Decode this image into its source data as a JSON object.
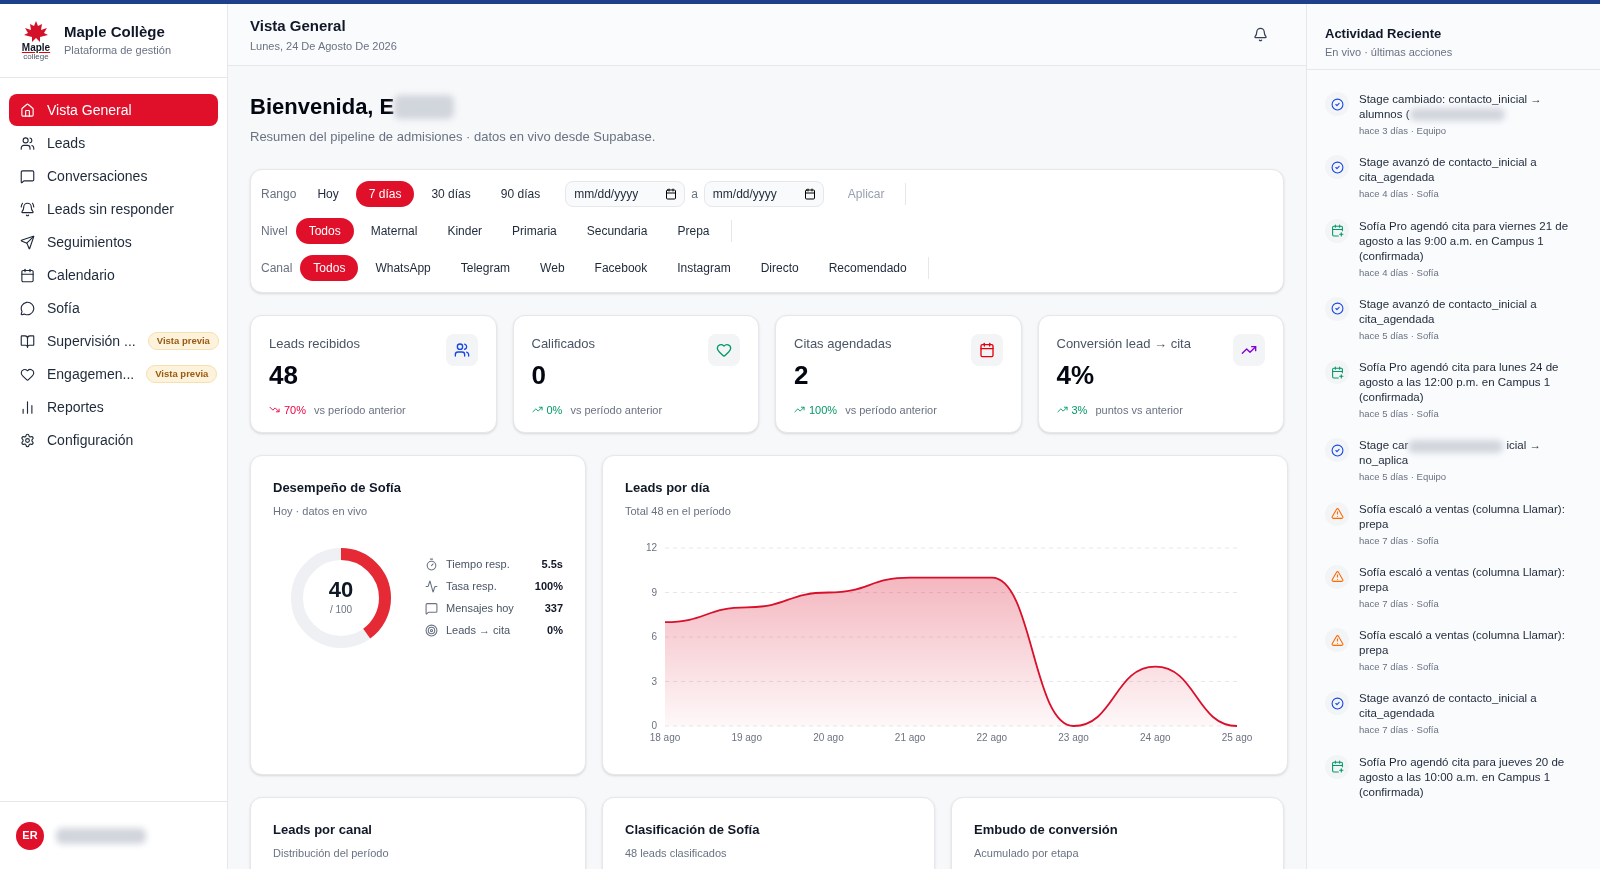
{
  "sidebar": {
    "logo": {
      "text": "Maple",
      "sub": "college"
    },
    "brand": "Maple Collège",
    "tagline": "Plataforma de gestión",
    "items": [
      {
        "label": "Vista General",
        "selected": true
      },
      {
        "label": "Leads",
        "selected": false
      },
      {
        "label": "Conversaciones",
        "selected": false
      },
      {
        "label": "Leads sin responder",
        "selected": false
      },
      {
        "label": "Seguimientos",
        "selected": false
      },
      {
        "label": "Calendario",
        "selected": false
      },
      {
        "label": "Sofía",
        "selected": false
      },
      {
        "label": "Supervisión ...",
        "selected": false,
        "badge": "Vista previa"
      },
      {
        "label": "Engagemen...",
        "selected": false,
        "badge": "Vista previa"
      },
      {
        "label": "Reportes",
        "selected": false
      },
      {
        "label": "Configuración",
        "selected": false
      }
    ],
    "user": {
      "initials": "ER"
    }
  },
  "header": {
    "title": "Vista General",
    "date": "Lunes, 24 De Agosto De 2026"
  },
  "welcome": {
    "title": "Bienvenida, E",
    "subtitle": "Resumen del pipeline de admisiones · datos en vivo desde Supabase."
  },
  "filters": [
    {
      "label": "Rango",
      "options": [
        {
          "label": "Hoy",
          "selected": false
        },
        {
          "label": "7 días",
          "selected": true
        },
        {
          "label": "30 días",
          "selected": false
        },
        {
          "label": "90 días",
          "selected": false
        }
      ],
      "date_from": {
        "placeholder": "mm/dd/yyyy"
      },
      "separator": "a",
      "date_to": {
        "placeholder": "mm/dd/yyyy"
      },
      "apply": "Aplicar"
    },
    {
      "label": "Nivel",
      "options": [
        {
          "label": "Todos",
          "selected": true
        },
        {
          "label": "Maternal",
          "selected": false
        },
        {
          "label": "Kinder",
          "selected": false
        },
        {
          "label": "Primaria",
          "selected": false
        },
        {
          "label": "Secundaria",
          "selected": false
        },
        {
          "label": "Prepa",
          "selected": false
        }
      ]
    },
    {
      "label": "Canal",
      "options": [
        {
          "label": "Todos",
          "selected": true
        },
        {
          "label": "WhatsApp",
          "selected": false
        },
        {
          "label": "Telegram",
          "selected": false
        },
        {
          "label": "Web",
          "selected": false
        },
        {
          "label": "Facebook",
          "selected": false
        },
        {
          "label": "Instagram",
          "selected": false
        },
        {
          "label": "Directo",
          "selected": false
        },
        {
          "label": "Recomendado",
          "selected": false
        }
      ]
    }
  ],
  "kpis": [
    {
      "label": "Leads recibidos",
      "value": "48",
      "trend_down": true,
      "change": "70%",
      "note": "vs período anterior"
    },
    {
      "label": "Calificados",
      "value": "0",
      "trend_down": false,
      "change": "0%",
      "note": "vs período anterior"
    },
    {
      "label": "Citas agendadas",
      "value": "2",
      "trend_down": false,
      "change": "100%",
      "note": "vs período anterior"
    },
    {
      "label": "Conversión lead → cita",
      "value": "4%",
      "trend_down": false,
      "change": "3%",
      "note": "puntos vs anterior"
    }
  ],
  "performance": {
    "title": "Desempeño de Sofía",
    "subtitle": "Hoy · datos en vivo",
    "score": "40",
    "max": "/ 100",
    "level": 0.4,
    "stats": [
      {
        "label": "Tiempo resp.",
        "value": "5.5s"
      },
      {
        "label": "Tasa resp.",
        "value": "100%"
      },
      {
        "label": "Mensajes hoy",
        "value": "337"
      },
      {
        "label": "Leads → cita",
        "value": "0%"
      }
    ]
  },
  "leads_per_day": {
    "title": "Leads por día",
    "subtitle": "Total 48 en el período",
    "chart_data": {
      "type": "area",
      "categories": [
        "18 ago",
        "19 ago",
        "20 ago",
        "21 ago",
        "22 ago",
        "23 ago",
        "24 ago",
        "25 ago"
      ],
      "series": [
        {
          "color": "#d90f2b",
          "values": [
            7,
            8,
            9,
            10,
            10,
            0,
            4,
            0
          ]
        }
      ],
      "ylim": [
        0,
        12
      ],
      "yticks": [
        0,
        3,
        6,
        9,
        12
      ],
      "grid": true
    }
  },
  "bottom_cards": [
    {
      "title": "Leads por canal",
      "subtitle": "Distribución del período"
    },
    {
      "title": "Clasificación de Sofía",
      "subtitle": "48 leads clasificados"
    },
    {
      "title": "Embudo de conversión",
      "subtitle": "Acumulado por etapa"
    }
  ],
  "activity": {
    "title": "Actividad Reciente",
    "subtitle": "En vivo · últimas acciones",
    "items": [
      {
        "kind": "stage",
        "text": "Stage cambiado: contacto_inicial → alumnos (",
        "redacted": true,
        "meta": "hace 3 días · Equipo"
      },
      {
        "kind": "stage",
        "text": "Stage avanzó de contacto_inicial a cita_agendada",
        "meta": "hace 4 días · Sofía"
      },
      {
        "kind": "appointment",
        "text": "Sofía Pro agendó cita para viernes 21 de agosto a las 9:00 a.m. en Campus 1 (confirmada)",
        "meta": "hace 4 días · Sofía"
      },
      {
        "kind": "stage",
        "text": "Stage avanzó de contacto_inicial a cita_agendada",
        "meta": "hace 5 días · Sofía"
      },
      {
        "kind": "appointment",
        "text": "Sofía Pro agendó cita para lunes 24 de agosto a las 12:00 p.m. en Campus 1 (confirmada)",
        "meta": "hace 5 días · Sofía"
      },
      {
        "kind": "stage",
        "text": "Stage car",
        "redacted": true,
        "tail": "icial → no_aplica",
        "meta": "hace 5 días · Equipo"
      },
      {
        "kind": "alert",
        "text": "Sofía escaló a ventas (columna Llamar): prepa",
        "meta": "hace 7 días · Sofía"
      },
      {
        "kind": "alert",
        "text": "Sofía escaló a ventas (columna Llamar): prepa",
        "meta": "hace 7 días · Sofía"
      },
      {
        "kind": "alert",
        "text": "Sofía escaló a ventas (columna Llamar): prepa",
        "meta": "hace 7 días · Sofía"
      },
      {
        "kind": "stage",
        "text": "Stage avanzó de contacto_inicial a cita_agendada",
        "meta": "hace 7 días · Sofía"
      },
      {
        "kind": "appointment",
        "text": "Sofía Pro agendó cita para jueves 20 de agosto a las 10:00 a.m. en Campus 1 (confirmada)"
      }
    ]
  }
}
